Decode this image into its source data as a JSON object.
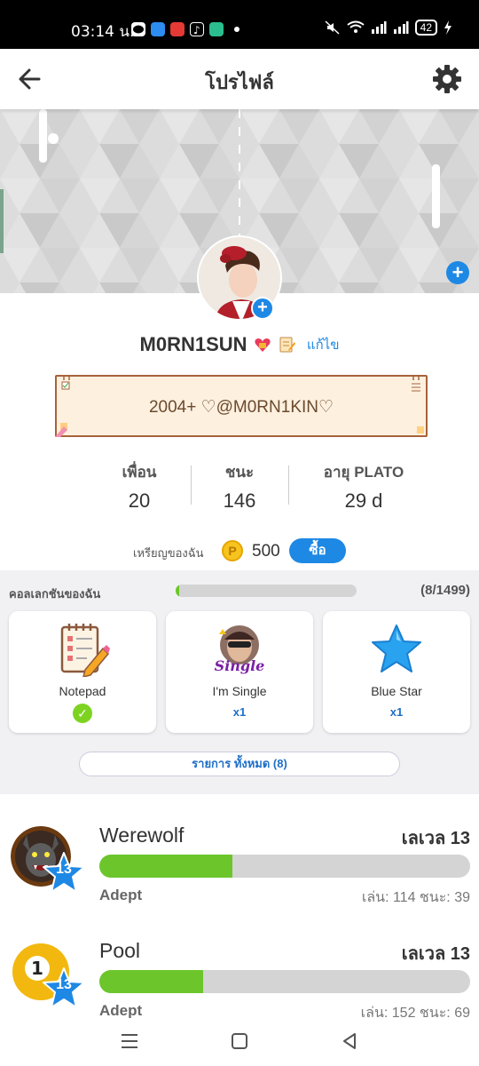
{
  "status_bar": {
    "time": "03:14 น.",
    "battery": "42",
    "notification_icons": [
      "line-icon",
      "messenger-icon",
      "video-icon",
      "tiktok-icon",
      "phone-icon"
    ]
  },
  "header": {
    "title": "โปรไฟล์",
    "back_icon": "back-arrow-icon",
    "settings_icon": "gear-icon"
  },
  "profile": {
    "username": "M0RN1SUN",
    "edit_label": "แก้ไข",
    "bio": "2004+ ♡@M0RN1KIN♡"
  },
  "stats": [
    {
      "label": "เพื่อน",
      "value": "20"
    },
    {
      "label": "ชนะ",
      "value": "146"
    },
    {
      "label": "อายุ PLATO",
      "value": "29 d"
    }
  ],
  "coins": {
    "label": "เหรียญของฉัน",
    "coin_symbol": "P",
    "amount": "500",
    "buy_label": "ซื้อ"
  },
  "collection": {
    "title": "คอลเลกชันของฉัน",
    "count": "(8/1499)",
    "progress": 0.0053,
    "items": [
      {
        "name": "Notepad",
        "icon": "notepad-icon",
        "owned": true,
        "qty": ""
      },
      {
        "name": "I'm Single",
        "icon": "single-avatar-icon",
        "owned": false,
        "qty": "x1",
        "image_text": "Single"
      },
      {
        "name": "Blue Star",
        "icon": "blue-star-icon",
        "owned": false,
        "qty": "x1"
      }
    ],
    "all_button": "รายการ ทั้งหมด (8)"
  },
  "games": [
    {
      "name": "Werewolf",
      "level_label": "เลเวล 13",
      "badge": "13",
      "rank": "Adept",
      "progress": 0.36,
      "stats": "เล่น: 114  ชนะ: 39",
      "icon": "werewolf-icon"
    },
    {
      "name": "Pool",
      "level_label": "เลเวล 13",
      "badge": "13",
      "rank": "Adept",
      "progress": 0.28,
      "stats": "เล่น: 152  ชนะ: 69",
      "icon": "pool-ball-icon",
      "ball_number": "1"
    }
  ],
  "colors": {
    "accent": "#1e88e5",
    "progress_green": "#6cc62b",
    "bio_border": "#a8623a",
    "bio_bg": "#fdf0df"
  }
}
